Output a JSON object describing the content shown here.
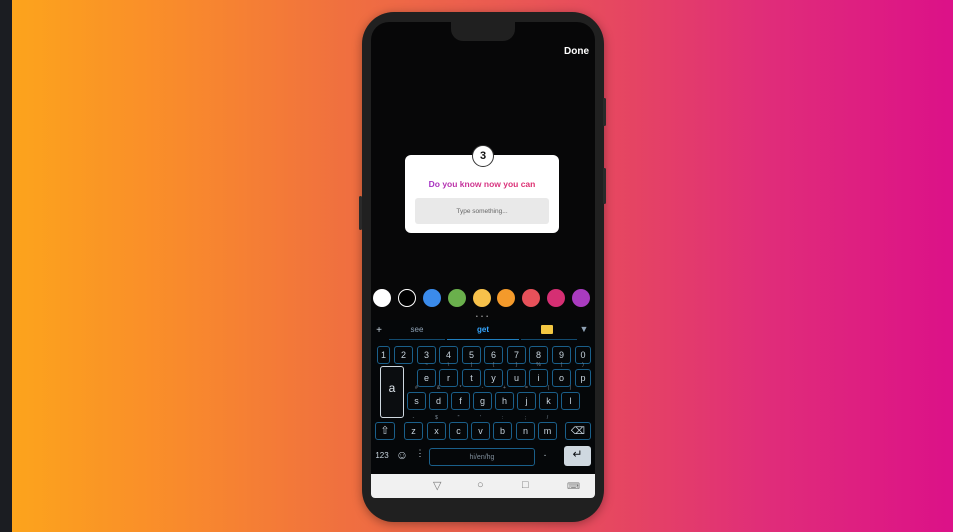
{
  "screen": {
    "done_label": "Done"
  },
  "question_card": {
    "sticker_glyph": "3",
    "question": "Do you know now you can",
    "placeholder": "Type something..."
  },
  "colors": [
    "#ffffff",
    "#000000",
    "#3b8beb",
    "#6ab04c",
    "#f7c14b",
    "#f49a2b",
    "#e7515a",
    "#d52f73",
    "#a93bbf"
  ],
  "pager": "• • •",
  "keyboard": {
    "suggestions": [
      "see",
      "get"
    ],
    "numbers": [
      "1",
      "2",
      "3",
      "4",
      "5",
      "6",
      "7",
      "8",
      "9",
      "0"
    ],
    "row1": [
      {
        "key": "a",
        "sub": ""
      },
      {
        "key": "e",
        "sub": "~"
      },
      {
        "key": "r",
        "sub": "\\"
      },
      {
        "key": "t",
        "sub": "|"
      },
      {
        "key": "y",
        "sub": "{"
      },
      {
        "key": "u",
        "sub": "}"
      },
      {
        "key": "i",
        "sub": "%"
      },
      {
        "key": "o",
        "sub": "("
      }
    ],
    "row2": [
      {
        "key": "s",
        "sub": "#"
      },
      {
        "key": "d",
        "sub": "&"
      },
      {
        "key": "f",
        "sub": "*"
      },
      {
        "key": "g",
        "sub": "-"
      },
      {
        "key": "h",
        "sub": "+"
      },
      {
        "key": "j",
        "sub": "="
      },
      {
        "key": "k",
        "sub": "("
      },
      {
        "key": "l",
        "sub": ")"
      }
    ],
    "row3": [
      {
        "key": "z",
        "sub": "-"
      },
      {
        "key": "x",
        "sub": "$"
      },
      {
        "key": "c",
        "sub": "\""
      },
      {
        "key": "v",
        "sub": "'"
      },
      {
        "key": "b",
        "sub": ":"
      },
      {
        "key": "n",
        "sub": ";"
      },
      {
        "key": "m",
        "sub": "/"
      }
    ],
    "mode_label": "123",
    "space_label": "hi/en/hg"
  }
}
